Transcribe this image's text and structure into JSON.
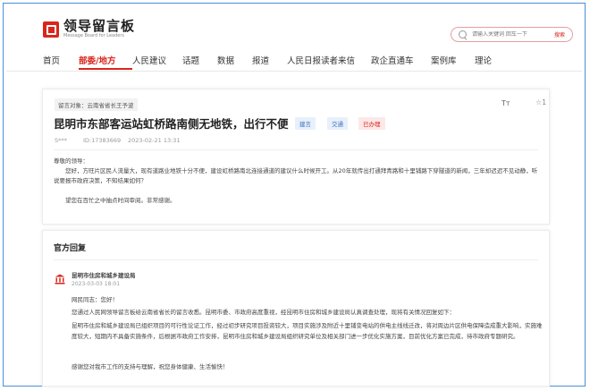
{
  "header": {
    "logo_title": "领导留言板",
    "logo_subtitle": "Message Board for Leaders",
    "search_placeholder": "请输入关键词 回车一下",
    "search_button": "搜索"
  },
  "nav": {
    "items": [
      "首页",
      "部委/地方",
      "人民建议",
      "话题",
      "数据",
      "报道",
      "人民日报读者来信",
      "政企直通车",
      "案例库",
      "理论"
    ],
    "active_index": 1
  },
  "message": {
    "recipient": "留言对象：云南省省长王予波",
    "font_toggle": "Tт",
    "star_count": "☆1",
    "title": "昆明市东部客运站虹桥路南侧无地铁，出行不便",
    "tags": [
      "建言",
      "交通"
    ],
    "status": "已办理",
    "author": "S***",
    "id": "ID:17383669",
    "date": "2023-02-21 13:31",
    "body": [
      "尊敬的领导：",
      "　　您好，方旺片区民人流量大，现有道路业地铁十分不便，建设虹桥路南北连接通道的建议什么时候开工。从20年就传出打通拜青路和十里铺路下穿隧道的新闻，三年却迟迟不见动静，听说要报市政府决策，不知结果如何？",
      "　　望您在百忙之中抽点时间审阅。非常感谢。"
    ]
  },
  "reply": {
    "heading": "官方回复",
    "org": "昆明市住房和城乡建设局",
    "date": "2023-03-03 18:01",
    "paragraphs": [
      "网民同志：您好！",
      "您通过人民网领导留言板给云南省省长的留言收悉。昆明市委、市政府高度重视，经昆明市住房和城乡建设局认真调查处理，现将有关情况回复如下：",
      "昆明市住房和城乡建设局已组织项目的可行性论证工作，经过初步研究项目投资较大，项目实施涉及附近十里铺变电站的供电主线线迁改，将对周边片区供电保障造成重大影响，实施难度较大，短期内不具备实施条件，后根据市政府工作安排，昆明市住房和城乡建设局组织研究单位及相关部门进一步优化实施方案，目前优化方案已完成，待市政府专题研究。",
      "感谢您对我市工作的支持与理解，祝您身体健康、生活愉快！"
    ]
  },
  "colors": {
    "accent": "#d9261c",
    "border": "#4a8fd8"
  }
}
